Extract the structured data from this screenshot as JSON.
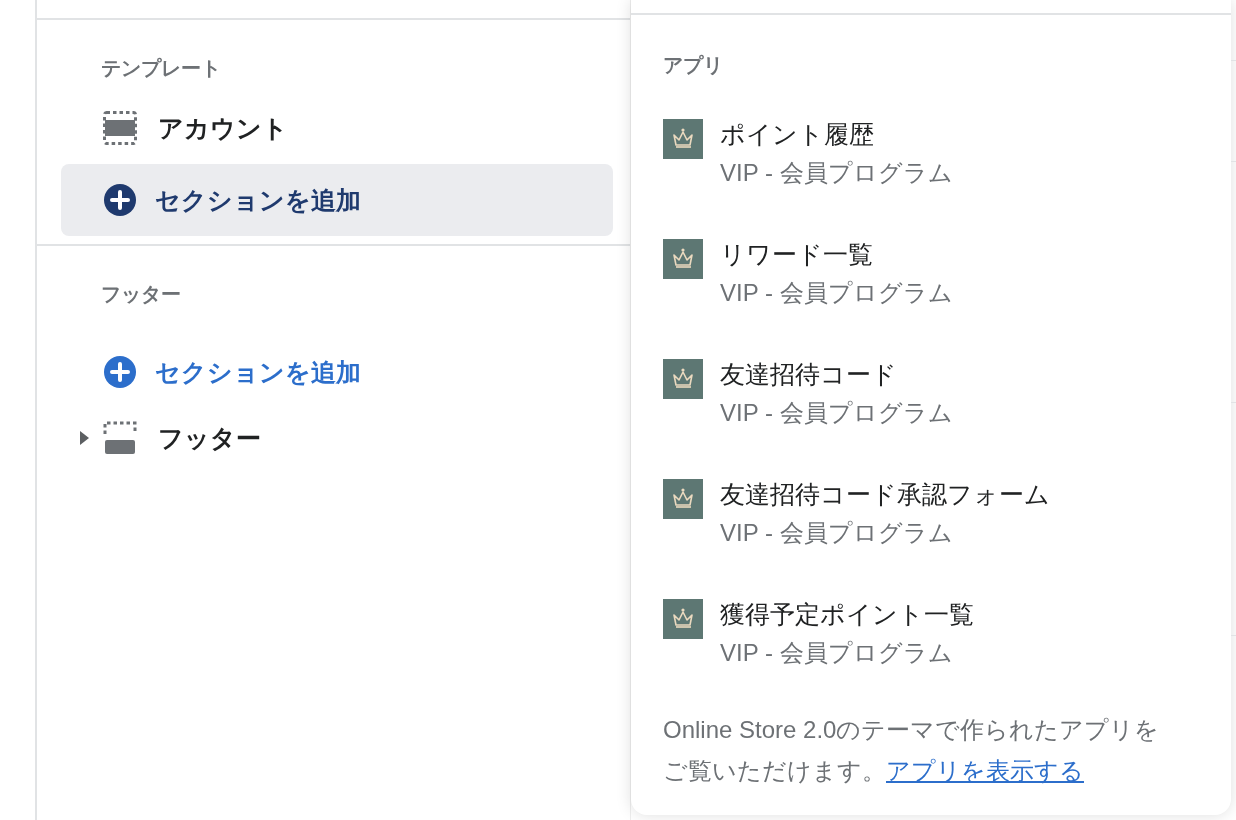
{
  "sidebar": {
    "groups": [
      {
        "heading": "テンプレート",
        "items": [
          {
            "kind": "body_section",
            "label": "アカウント"
          },
          {
            "kind": "add",
            "label": "セクションを追加",
            "selected": true
          }
        ]
      },
      {
        "heading": "フッター",
        "items": [
          {
            "kind": "add",
            "label": "セクションを追加",
            "selected": false
          },
          {
            "kind": "footer_section",
            "label": "フッター",
            "expanded": false
          }
        ]
      }
    ]
  },
  "popover": {
    "heading": "アプリ",
    "apps": [
      {
        "title": "ポイント履歴",
        "subtitle": "VIP - 会員プログラム"
      },
      {
        "title": "リワード一覧",
        "subtitle": "VIP - 会員プログラム"
      },
      {
        "title": "友達招待コード",
        "subtitle": "VIP - 会員プログラム"
      },
      {
        "title": "友達招待コード承認フォーム",
        "subtitle": "VIP - 会員プログラム"
      },
      {
        "title": "獲得予定ポイント一覧",
        "subtitle": "VIP - 会員プログラム"
      }
    ],
    "note": "Online Store 2.0のテーマで作られたアプリをご覧いただけます。",
    "link": "アプリを表示する"
  }
}
